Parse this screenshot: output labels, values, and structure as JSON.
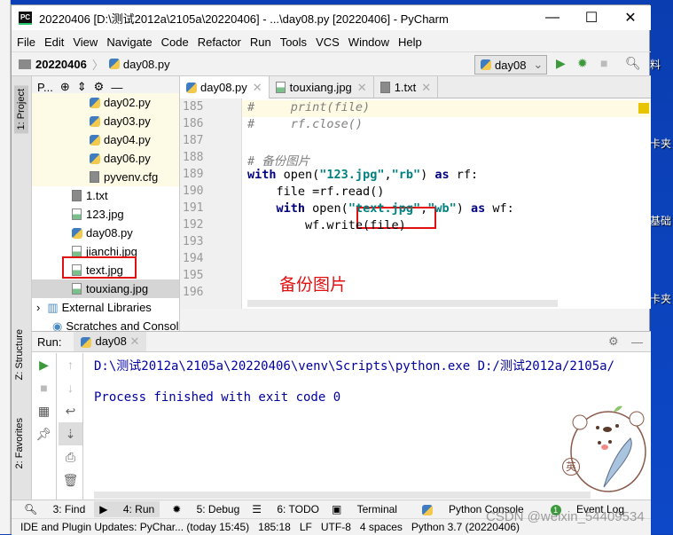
{
  "desktop": {
    "labels": [
      "料",
      "卡夹",
      "基础",
      "卡夹"
    ]
  },
  "window": {
    "title": "20220406 [D:\\测试2012a\\2105a\\20220406] - ...\\day08.py [20220406] - PyCharm",
    "logo": "PC"
  },
  "menu": [
    "File",
    "Edit",
    "View",
    "Navigate",
    "Code",
    "Refactor",
    "Run",
    "Tools",
    "VCS",
    "Window",
    "Help"
  ],
  "breadcrumb": [
    "20220406",
    "day08.py"
  ],
  "toolbar": {
    "run_config": "day08"
  },
  "tool_windows": {
    "project": "1: Project",
    "structure": "Z: Structure",
    "favorites": "2: Favorites"
  },
  "project": {
    "header": "P...",
    "items": [
      {
        "name": "day02.py",
        "type": "py"
      },
      {
        "name": "day03.py",
        "type": "py"
      },
      {
        "name": "day04.py",
        "type": "py"
      },
      {
        "name": "day06.py",
        "type": "py"
      },
      {
        "name": "pyvenv.cfg",
        "type": "txt"
      },
      {
        "name": "1.txt",
        "type": "txt"
      },
      {
        "name": "123.jpg",
        "type": "img"
      },
      {
        "name": "day08.py",
        "type": "py"
      },
      {
        "name": "jianchi.jpg",
        "type": "img"
      },
      {
        "name": "text.jpg",
        "type": "img"
      },
      {
        "name": "touxiang.jpg",
        "type": "img"
      },
      {
        "name": "External Libraries",
        "type": "lib"
      },
      {
        "name": "Scratches and Consol",
        "type": "scratch"
      }
    ]
  },
  "editor": {
    "tabs": [
      "day08.py",
      "touxiang.jpg",
      "1.txt"
    ],
    "lines": [
      {
        "n": "185",
        "html": "<span class='cmt'>#     print(file)</span>"
      },
      {
        "n": "186",
        "html": "<span class='cmt'>#     rf.close()</span>"
      },
      {
        "n": "187",
        "html": ""
      },
      {
        "n": "188",
        "html": "<span class='cmt'># 备份图片</span>"
      },
      {
        "n": "189",
        "html": "<span class='kw'>with</span> open(<span class='str'>\"123.jpg\"</span>,<span class='str'>\"rb\"</span>) <span class='kw'>as</span> rf:"
      },
      {
        "n": "190",
        "html": "    file =rf.read()"
      },
      {
        "n": "191",
        "html": "    <span class='kw'>with</span> open(<span class='str'>\"text.jpg\"</span>,<span class='str'>\"wb\"</span>) <span class='kw'>as</span> wf:"
      },
      {
        "n": "192",
        "html": "        wf.write(file)"
      },
      {
        "n": "193",
        "html": ""
      },
      {
        "n": "194",
        "html": ""
      },
      {
        "n": "195",
        "html": ""
      },
      {
        "n": "196",
        "html": ""
      }
    ],
    "annotation": "备份图片"
  },
  "run": {
    "label": "Run:",
    "tab": "day08",
    "command": "D:\\测试2012a\\2105a\\20220406\\venv\\Scripts\\python.exe D:/测试2012a/2105a/",
    "result": "Process finished with exit code 0"
  },
  "bottom_tools": [
    "3: Find",
    "4: Run",
    "5: Debug",
    "6: TODO",
    "Terminal",
    "Python Console",
    "Event Log"
  ],
  "event_log_count": "1",
  "status": {
    "message": "IDE and Plugin Updates: PyChar... (today 15:45)",
    "position": "185:18",
    "line_sep": "LF",
    "encoding": "UTF-8",
    "indent": "4 spaces",
    "interpreter": "Python 3.7 (20220406)"
  },
  "watermark": "CSDN @weixin_54409534",
  "sticker": {
    "labels": [
      "英"
    ]
  }
}
